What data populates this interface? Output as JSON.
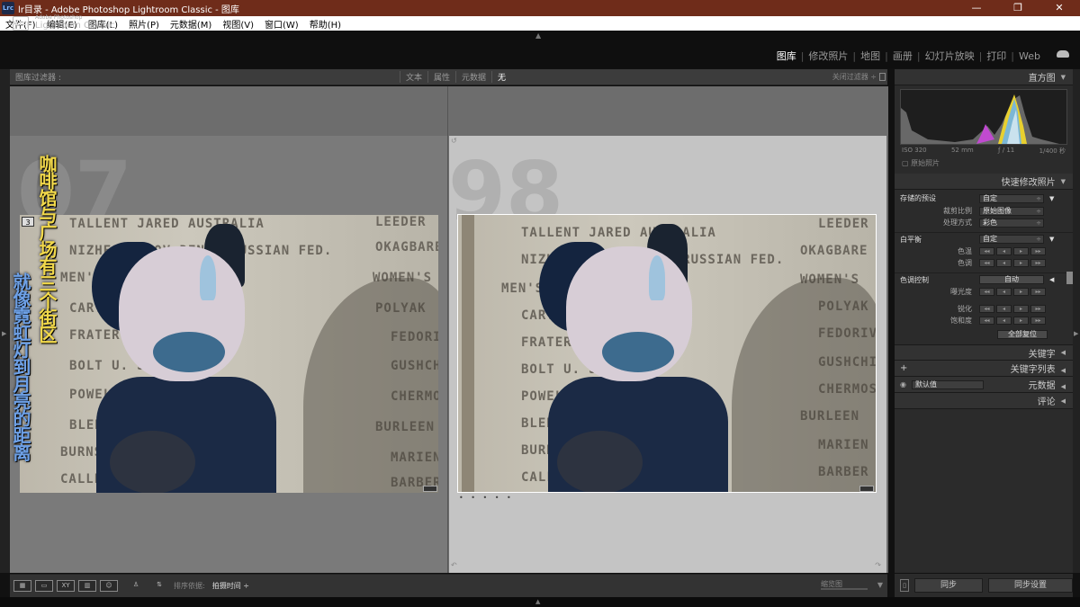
{
  "window": {
    "title": "lr目录 - Adobe Photoshop Lightroom Classic - 图库",
    "app_badge": "Lrc",
    "minimize": "—",
    "maximize": "❐",
    "close": "✕"
  },
  "menu": [
    "文件(F)",
    "编辑(E)",
    "图库(L)",
    "照片(P)",
    "元数据(M)",
    "视图(V)",
    "窗口(W)",
    "帮助(H)"
  ],
  "identity": {
    "logo": "Lrc",
    "brand_line1": "Adobe Photoshop",
    "brand_line2": "Lightroom Classic"
  },
  "modules": [
    "图库",
    "修改照片",
    "地图",
    "画册",
    "幻灯片放映",
    "打印",
    "Web"
  ],
  "filter_bar": {
    "title": "图库过滤器 :",
    "options": [
      "文本",
      "属性",
      "元数据",
      "无"
    ],
    "selected": "无",
    "filter_off": "关闭过滤器 ÷"
  },
  "compare": {
    "left_number": "07",
    "right_number": "98",
    "left_badge": "3",
    "dots": "• • • • •",
    "plaques": [
      "TALLENT JARED  AUSTRALIA",
      "NIZHEGORODOV DENIS  RUSSIAN FED.",
      "MEN'S",
      "CARTER  JAMAICA",
      "FRATER  JAMAICA",
      "BOLT U.  JAMAICA",
      "POWELL A.  JAMAICA",
      "BLEDMAN  TRIN./TOBAGO",
      "BURNS",
      "CALLENDER",
      "LEEDER",
      "OKAGBARE",
      "WOMEN'S",
      "POLYAK",
      "FEDORIV",
      "GUSHCHINA",
      "CHERMOSHAN",
      "BURLEEN",
      "MARIEN",
      "BARBER"
    ],
    "overlay_text_yellow": "咖啡馆与广场有三个街区",
    "overlay_text_blue": "就像霓虹灯到月亮的距离"
  },
  "right_panel": {
    "histogram_title": "直方图",
    "iso": "ISO 320",
    "focal": "52 mm",
    "aperture": "ƒ / 11",
    "shutter": "1/400 秒",
    "original_photo": "原始照片",
    "quick_develop_title": "快速修改照片",
    "saved_preset_label": "存储的预设",
    "saved_preset_value": "自定",
    "crop_label": "裁剪比例",
    "crop_value": "原始图像",
    "treatment_label": "处理方式",
    "treatment_value": "彩色",
    "wb_label": "白平衡",
    "wb_value": "自定",
    "temp_label": "色温",
    "tint_label": "色调",
    "tone_label": "色调控制",
    "auto_label": "自动",
    "exposure_label": "曝光度",
    "clarity_label": "锐化",
    "vibrance_label": "饱和度",
    "reset_all": "全部复位",
    "keywording": "关键字",
    "keyword_list": "关键字列表",
    "metadata": "元数据",
    "metadata_preset": "默认值",
    "comments": "评论",
    "plus": "+"
  },
  "toolbar": {
    "sort_label": "排序依据:",
    "sort_value": "拍摄时间 ÷",
    "thumbnails": "缩览图",
    "dropdown": "▼"
  },
  "sync": {
    "sync_label": "同步",
    "sync_settings_label": "同步设置"
  },
  "colors": {
    "titlebar": "#6f2c1a",
    "accent_yellow": "#f1d84a",
    "accent_blue": "#6da0e6"
  }
}
